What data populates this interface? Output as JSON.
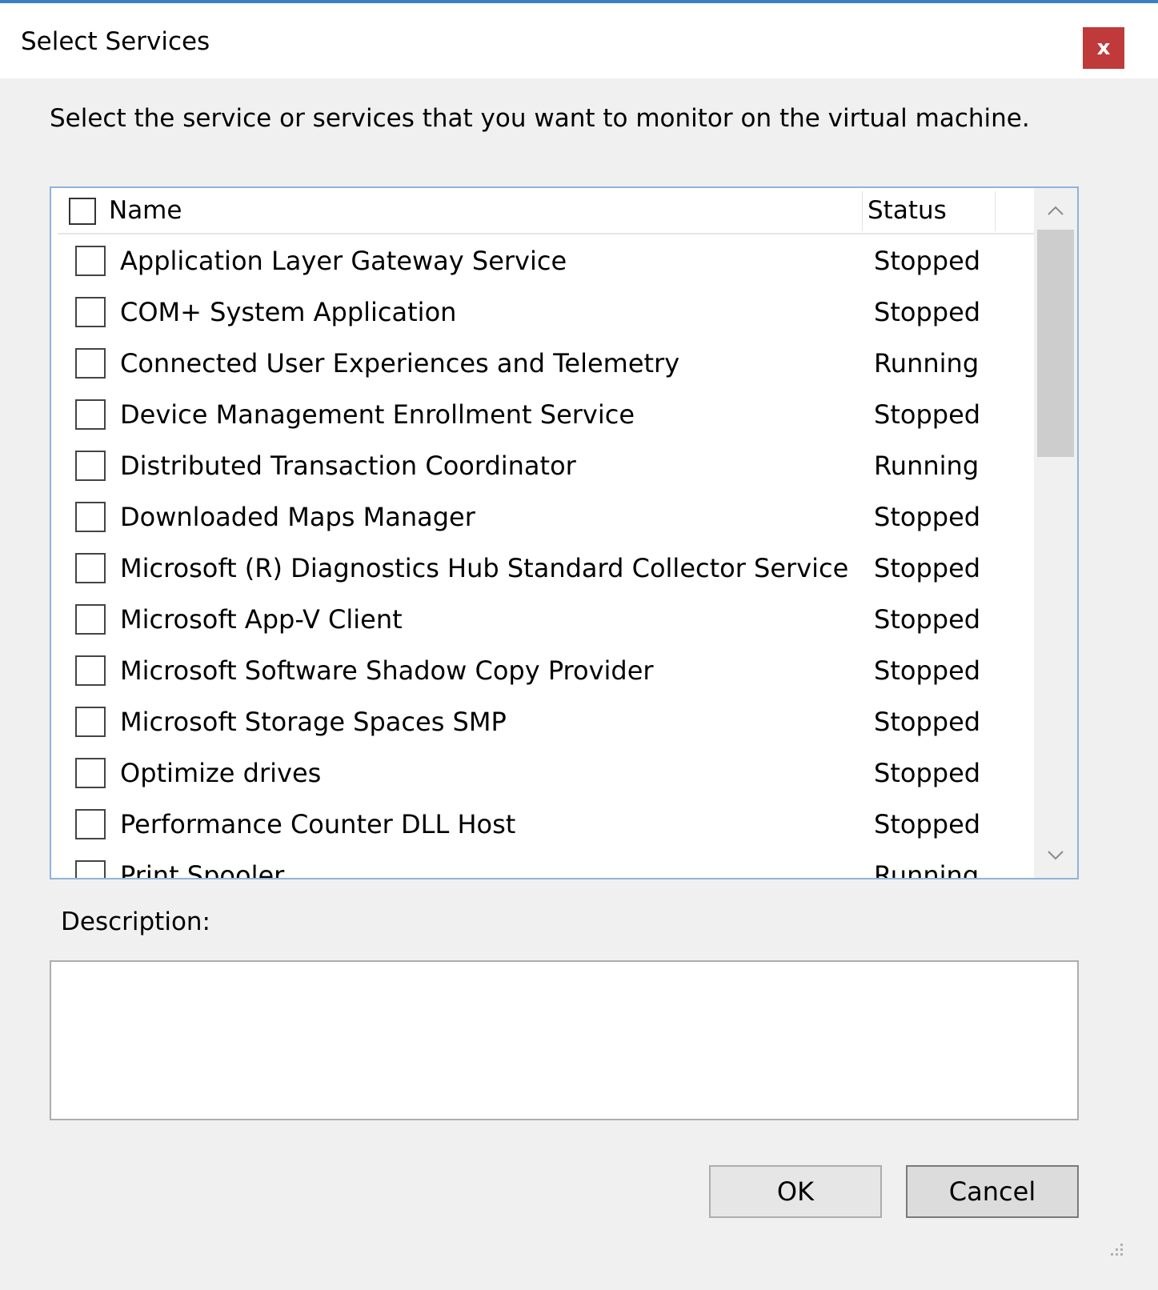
{
  "window": {
    "title": "Select Services",
    "close_label": "x",
    "accent_color": "#3a7fc4",
    "close_color": "#c0393b"
  },
  "instruction": "Select the service or services that you want to monitor on the virtual machine.",
  "list": {
    "columns": {
      "name": "Name",
      "status": "Status"
    },
    "select_all_checked": false,
    "rows": [
      {
        "name": "Application Layer Gateway Service",
        "status": "Stopped",
        "checked": false
      },
      {
        "name": "COM+ System Application",
        "status": "Stopped",
        "checked": false
      },
      {
        "name": "Connected User Experiences and Telemetry",
        "status": "Running",
        "checked": false
      },
      {
        "name": "Device Management Enrollment Service",
        "status": "Stopped",
        "checked": false
      },
      {
        "name": "Distributed Transaction Coordinator",
        "status": "Running",
        "checked": false
      },
      {
        "name": "Downloaded Maps Manager",
        "status": "Stopped",
        "checked": false
      },
      {
        "name": "Microsoft (R) Diagnostics Hub Standard Collector Service",
        "status": "Stopped",
        "checked": false
      },
      {
        "name": "Microsoft App-V Client",
        "status": "Stopped",
        "checked": false
      },
      {
        "name": "Microsoft Software Shadow Copy Provider",
        "status": "Stopped",
        "checked": false
      },
      {
        "name": "Microsoft Storage Spaces SMP",
        "status": "Stopped",
        "checked": false
      },
      {
        "name": "Optimize drives",
        "status": "Stopped",
        "checked": false
      },
      {
        "name": "Performance Counter DLL Host",
        "status": "Stopped",
        "checked": false
      },
      {
        "name": "Print Spooler",
        "status": "Running",
        "checked": false
      }
    ]
  },
  "description": {
    "label": "Description:",
    "value": ""
  },
  "buttons": {
    "ok": "OK",
    "cancel": "Cancel"
  }
}
